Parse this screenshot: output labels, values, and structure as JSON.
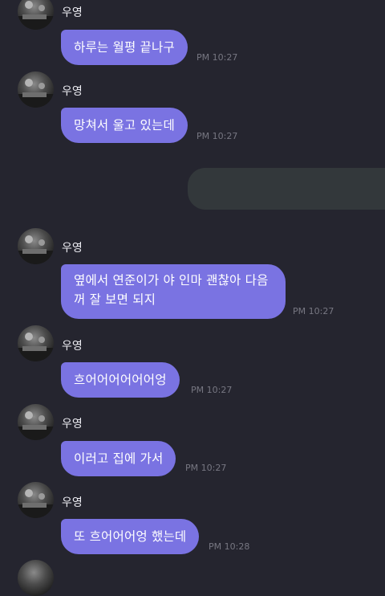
{
  "messages": [
    {
      "sender": "우영",
      "text": "하루는 월평 끝나구",
      "time": "PM 10:27"
    },
    {
      "sender": "우영",
      "text": "망쳐서 울고 있는데",
      "time": "PM 10:27"
    },
    {
      "sender": "우영",
      "text": "옆에서 연준이가 야 인마 괜찮아 다음\n꺼 잘 보면 되지",
      "time": "PM 10:27"
    },
    {
      "sender": "우영",
      "text": "흐어어어어어어엉",
      "time": "PM 10:27"
    },
    {
      "sender": "우영",
      "text": "이러고 집에 가서",
      "time": "PM 10:27"
    },
    {
      "sender": "우영",
      "text": "또 흐어어어엉 했는데",
      "time": "PM 10:28"
    }
  ],
  "colors": {
    "background": "#25252f",
    "received_bubble": "#7a73e2",
    "sent_bubble": "#33383b",
    "timestamp": "#777782"
  }
}
